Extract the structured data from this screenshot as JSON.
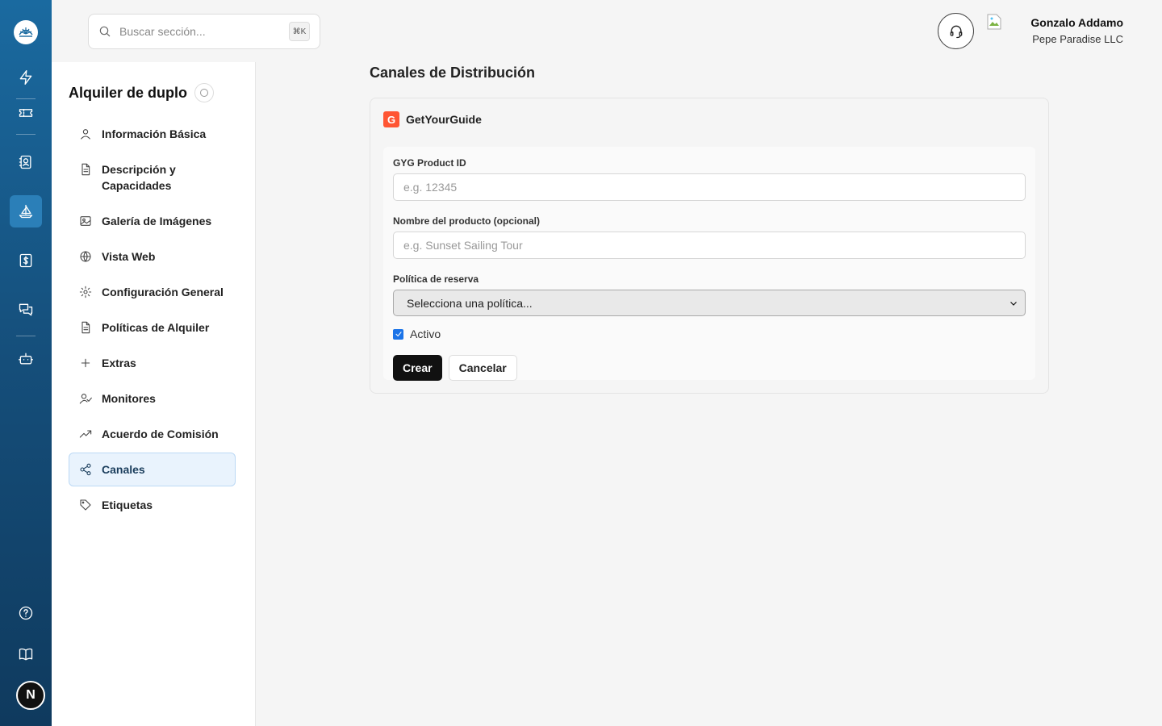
{
  "search": {
    "placeholder": "Buscar sección...",
    "shortcut": "⌘K"
  },
  "user": {
    "name": "Gonzalo Addamo",
    "org": "Pepe Paradise LLC",
    "avatar_initial": "N"
  },
  "rail": {
    "items": [
      {
        "icon": "lightning-icon"
      },
      {
        "icon": "ticket-icon"
      },
      {
        "icon": "contacts-icon"
      },
      {
        "icon": "sailboat-icon",
        "active": true
      },
      {
        "icon": "dollar-icon"
      },
      {
        "icon": "chat-icon"
      },
      {
        "icon": "robot-icon"
      }
    ],
    "bottom": [
      {
        "icon": "help-icon"
      },
      {
        "icon": "book-icon"
      }
    ]
  },
  "sidebar": {
    "title": "Alquiler de duplo",
    "items": [
      {
        "label": "Información Básica",
        "icon": "user-icon"
      },
      {
        "label": "Descripción y Capacidades",
        "icon": "document-icon"
      },
      {
        "label": "Galería de Imágenes",
        "icon": "image-icon"
      },
      {
        "label": "Vista Web",
        "icon": "globe-icon"
      },
      {
        "label": "Configuración General",
        "icon": "gear-icon"
      },
      {
        "label": "Políticas de Alquiler",
        "icon": "document-icon"
      },
      {
        "label": "Extras",
        "icon": "plus-icon"
      },
      {
        "label": "Monitores",
        "icon": "user-check-icon"
      },
      {
        "label": "Acuerdo de Comisión",
        "icon": "trending-up-icon"
      },
      {
        "label": "Canales",
        "icon": "share-icon",
        "active": true
      },
      {
        "label": "Etiquetas",
        "icon": "tag-icon"
      }
    ]
  },
  "main": {
    "title": "Canales de Distribución",
    "channel": {
      "name": "GetYourGuide",
      "logo_letter": "G",
      "logo_color": "#ff5533",
      "fields": {
        "product_id_label": "GYG Product ID",
        "product_id_placeholder": "e.g. 12345",
        "product_name_label": "Nombre del producto (opcional)",
        "product_name_placeholder": "e.g. Sunset Sailing Tour",
        "policy_label": "Política de reserva",
        "policy_value": "Selecciona una política...",
        "active_label": "Activo",
        "active_checked": true
      },
      "buttons": {
        "create": "Crear",
        "cancel": "Cancelar"
      }
    }
  }
}
